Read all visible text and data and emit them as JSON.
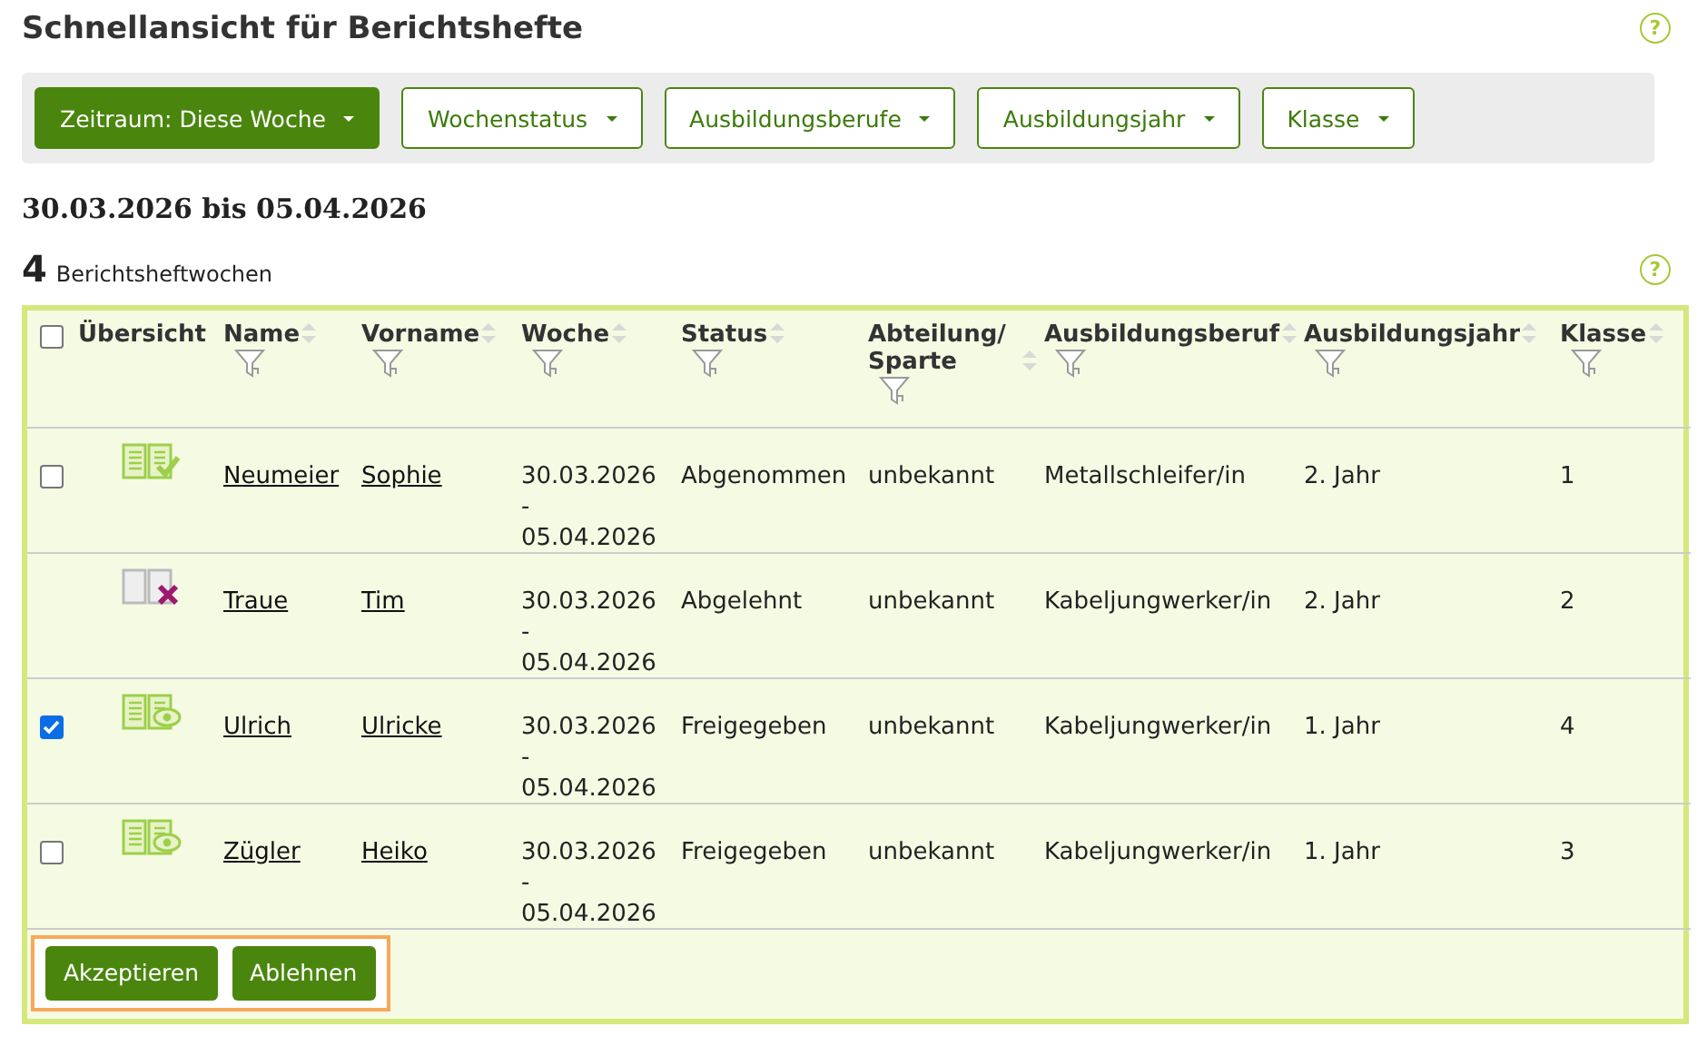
{
  "page": {
    "title": "Schnellansicht für Berichtshefte",
    "help": "?"
  },
  "filters": [
    {
      "label": "Zeitraum: Diese Woche",
      "selected": true
    },
    {
      "label": "Wochenstatus",
      "selected": false
    },
    {
      "label": "Ausbildungsberufe",
      "selected": false
    },
    {
      "label": "Ausbildungsjahr",
      "selected": false
    },
    {
      "label": "Klasse",
      "selected": false
    }
  ],
  "range": "30.03.2026 bis 05.04.2026",
  "count": {
    "number": "4",
    "label": "Berichtsheftwochen",
    "help": "?"
  },
  "table": {
    "select_all": {
      "checked": false
    },
    "columns": [
      {
        "label": "Übersicht",
        "kind": "plain"
      },
      {
        "label": "Name",
        "kind": "sort_filter"
      },
      {
        "label": "Vorname",
        "kind": "sort_filter"
      },
      {
        "label": "Woche",
        "kind": "sort_filter"
      },
      {
        "label": "Status",
        "kind": "sort_filter"
      },
      {
        "label": "Abteilung/ Sparte",
        "kind": "sort_filter"
      },
      {
        "label": "Ausbildungsberuf",
        "kind": "sort_filter"
      },
      {
        "label": "Ausbildungsjahr",
        "kind": "sort_filter"
      },
      {
        "label": "Klasse",
        "kind": "sort_filter"
      }
    ],
    "rows": [
      {
        "checked": false,
        "kind": "accepted",
        "name": "Neumeier",
        "first_name": "Sophie",
        "week": "30.03.2026 - 05.04.2026",
        "status": "Abgenommen",
        "department": "unbekannt",
        "occupation": "Metallschleifer/in",
        "year": "2. Jahr",
        "class": "1"
      },
      {
        "kind": "rejected",
        "name": "Traue",
        "first_name": "Tim",
        "week": "30.03.2026 - 05.04.2026",
        "status": "Abgelehnt",
        "department": "unbekannt",
        "occupation": "Kabeljungwerker/in",
        "year": "2. Jahr",
        "class": "2"
      },
      {
        "checked": true,
        "kind": "released",
        "name": "Ulrich",
        "first_name": "Ulricke",
        "week": "30.03.2026 - 05.04.2026",
        "status": "Freigegeben",
        "department": "unbekannt",
        "occupation": "Kabeljungwerker/in",
        "year": "1. Jahr",
        "class": "4"
      },
      {
        "checked": false,
        "kind": "released",
        "name": "Zügler",
        "first_name": "Heiko",
        "week": "30.03.2026 - 05.04.2026",
        "status": "Freigegeben",
        "department": "unbekannt",
        "occupation": "Kabeljungwerker/in",
        "year": "1. Jahr",
        "class": "3"
      }
    ],
    "actions": [
      "Akzeptieren",
      "Ablehnen"
    ]
  }
}
